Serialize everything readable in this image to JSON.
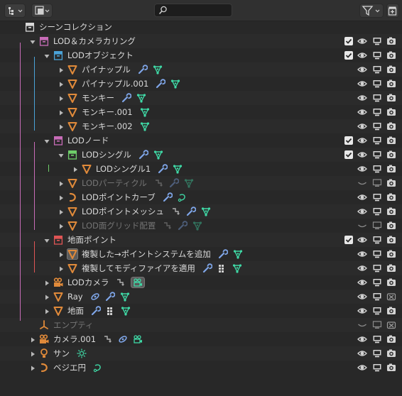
{
  "header": {
    "display_mode_icon": "outliner-display-icon",
    "view_icon": "filter-view-icon",
    "search_placeholder": "",
    "filter_icon": "funnel-icon",
    "new_collection_icon": "new-collection-icon"
  },
  "colors": {
    "background": "#282828",
    "collection_white": "#d8d8d8",
    "collection_blue": "#4aa3d8",
    "collection_pink": "#c86cb8",
    "collection_green": "#6fcf6a",
    "collection_red": "#e05555",
    "object_orange": "#e08a3a",
    "modifier_blue": "#7fa6e8",
    "data_green": "#3fd9a6",
    "constraint_gray": "#b0b0b0"
  },
  "rows": [
    {
      "label": "シーンコレクション",
      "indent": 0,
      "arrow": "none",
      "icon": "collection-white-icon",
      "dim": false,
      "minis": [],
      "cb": false,
      "rt": "none"
    },
    {
      "label": "LOD＆カメラカリング",
      "indent": 1,
      "arrow": "open",
      "icon": "collection-pink-icon",
      "dim": false,
      "minis": [],
      "cb": true,
      "rt": "full"
    },
    {
      "label": "LODオブジェクト",
      "indent": 2,
      "arrow": "open",
      "icon": "collection-blue-icon",
      "dim": false,
      "minis": [],
      "cb": true,
      "rt": "full"
    },
    {
      "label": "パイナップル",
      "indent": 3,
      "arrow": "closed",
      "icon": "mesh-object-icon",
      "dim": false,
      "minis": [
        "wrench",
        "mesh-data"
      ],
      "cb": false,
      "rt": "full"
    },
    {
      "label": "パイナップル.001",
      "indent": 3,
      "arrow": "closed",
      "icon": "mesh-object-icon",
      "dim": false,
      "minis": [
        "wrench",
        "mesh-data"
      ],
      "cb": false,
      "rt": "full"
    },
    {
      "label": "モンキー",
      "indent": 3,
      "arrow": "closed",
      "icon": "mesh-object-icon",
      "dim": false,
      "minis": [
        "wrench",
        "mesh-data"
      ],
      "cb": false,
      "rt": "full"
    },
    {
      "label": "モンキー.001",
      "indent": 3,
      "arrow": "closed",
      "icon": "mesh-object-icon",
      "dim": false,
      "minis": [
        "mesh-data"
      ],
      "cb": false,
      "rt": "full"
    },
    {
      "label": "モンキー.002",
      "indent": 3,
      "arrow": "closed",
      "icon": "mesh-object-icon",
      "dim": false,
      "minis": [
        "mesh-data"
      ],
      "cb": false,
      "rt": "full"
    },
    {
      "label": "LODノード",
      "indent": 2,
      "arrow": "open",
      "icon": "collection-pink-icon",
      "dim": false,
      "minis": [],
      "cb": true,
      "rt": "full"
    },
    {
      "label": "LODシングル",
      "indent": 3,
      "arrow": "open",
      "icon": "collection-green-icon",
      "dim": false,
      "minis": [
        "wrench",
        "mesh-data"
      ],
      "cb": true,
      "rt": "full"
    },
    {
      "label": "LODシングル1",
      "indent": 4,
      "arrow": "closed",
      "icon": "mesh-object-icon",
      "dim": false,
      "minis": [
        "wrench",
        "mesh-data"
      ],
      "cb": false,
      "rt": "full"
    },
    {
      "label": "LODパーティクル",
      "indent": 3,
      "arrow": "closed",
      "icon": "mesh-object-icon",
      "dim": true,
      "minis": [
        "constraint",
        "wrench",
        "mesh-data"
      ],
      "cb": false,
      "rt": "hidden"
    },
    {
      "label": "LODポイントカーブ",
      "indent": 3,
      "arrow": "closed",
      "icon": "curve-object-icon",
      "dim": false,
      "minis": [
        "wrench",
        "curve-data"
      ],
      "cb": false,
      "rt": "full"
    },
    {
      "label": "LODポイントメッシュ",
      "indent": 3,
      "arrow": "closed",
      "icon": "mesh-object-icon",
      "dim": false,
      "minis": [
        "constraint",
        "wrench",
        "mesh-data"
      ],
      "cb": false,
      "rt": "full"
    },
    {
      "label": "LOD面グリッド配置",
      "indent": 3,
      "arrow": "closed",
      "icon": "mesh-object-icon",
      "dim": true,
      "minis": [
        "constraint",
        "wrench",
        "mesh-data"
      ],
      "cb": false,
      "rt": "hidden"
    },
    {
      "label": "地面ポイント",
      "indent": 2,
      "arrow": "open",
      "icon": "collection-red-icon",
      "dim": false,
      "minis": [],
      "cb": true,
      "rt": "full"
    },
    {
      "label": "複製した→ポイントシステムを追加",
      "indent": 3,
      "arrow": "closed",
      "icon": "mesh-object-boxed-icon",
      "dim": false,
      "minis": [
        "wrench",
        "mesh-data"
      ],
      "cb": false,
      "rt": "full"
    },
    {
      "label": "複製してモディファイアを適用",
      "indent": 3,
      "arrow": "closed",
      "icon": "mesh-object-icon",
      "dim": false,
      "minis": [
        "wrench",
        "grid",
        "mesh-data"
      ],
      "cb": false,
      "rt": "full"
    },
    {
      "label": "LODカメラ",
      "indent": 2,
      "arrow": "closed",
      "icon": "camera-object-icon",
      "dim": false,
      "minis": [
        "constraint",
        "camera-data-boxed"
      ],
      "cb": false,
      "rt": "full"
    },
    {
      "label": "Ray",
      "indent": 2,
      "arrow": "closed",
      "icon": "mesh-object-icon",
      "dim": false,
      "minis": [
        "link",
        "wrench",
        "mesh-data"
      ],
      "cb": false,
      "rt": "disabled"
    },
    {
      "label": "地面",
      "indent": 2,
      "arrow": "closed",
      "icon": "mesh-object-icon",
      "dim": false,
      "minis": [
        "wrench",
        "grid",
        "mesh-data"
      ],
      "cb": false,
      "rt": "full"
    },
    {
      "label": "エンプティ",
      "indent": 1,
      "arrow": "none",
      "icon": "empty-object-icon",
      "dim": true,
      "minis": [],
      "cb": false,
      "rt": "hidden-disabled"
    },
    {
      "label": "カメラ.001",
      "indent": 1,
      "arrow": "closed",
      "icon": "camera-object-icon",
      "dim": false,
      "minis": [
        "constraint",
        "link",
        "camera-data"
      ],
      "cb": false,
      "rt": "full"
    },
    {
      "label": "サン",
      "indent": 1,
      "arrow": "closed",
      "icon": "light-object-icon",
      "dim": false,
      "minis": [
        "sun-data"
      ],
      "cb": false,
      "rt": "full"
    },
    {
      "label": "ベジエ円",
      "indent": 1,
      "arrow": "closed",
      "icon": "curve-object-icon",
      "dim": false,
      "minis": [
        "curve-data"
      ],
      "cb": false,
      "rt": "full"
    }
  ]
}
